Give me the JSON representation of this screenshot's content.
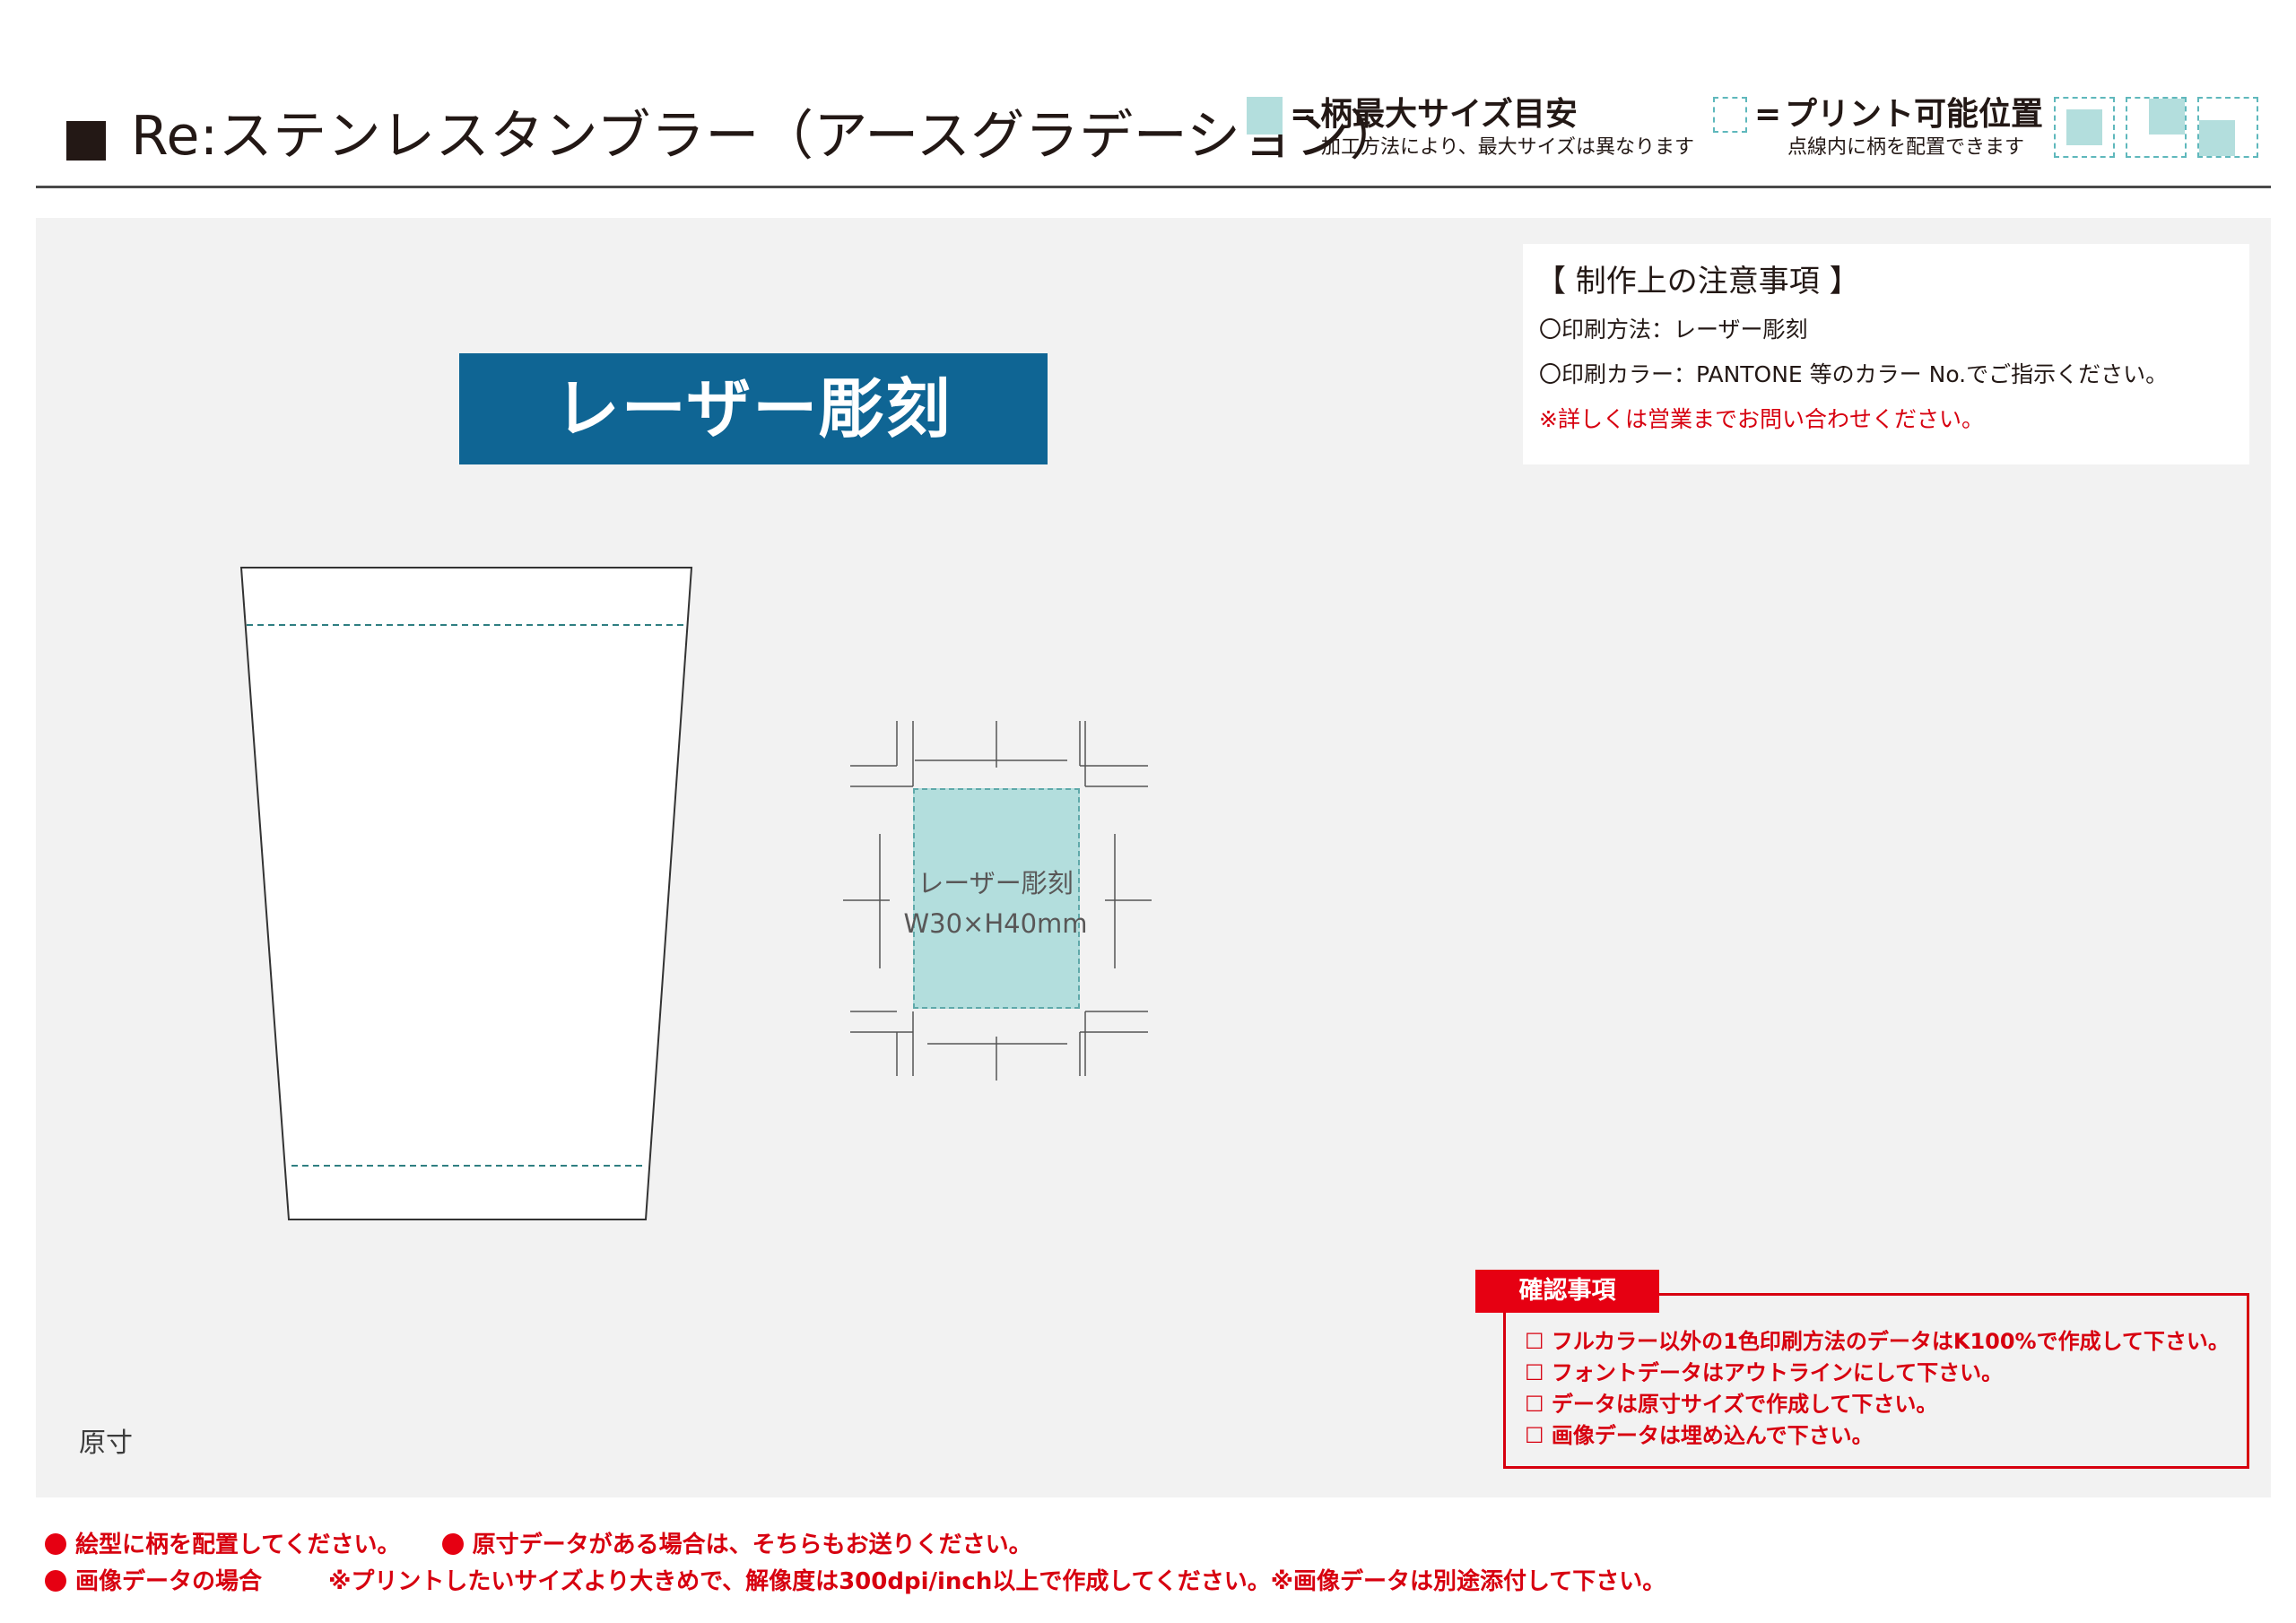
{
  "header": {
    "title": "Re:ステンレスタンブラー（アースグラデーション）",
    "legend_max": {
      "eq": "=",
      "title": "柄最大サイズ目安",
      "note": "加工方法により、最大サイズは異なります",
      "color": "#b3dedd"
    },
    "legend_print": {
      "eq": "=",
      "title": "プリント可能位置",
      "note": "点線内に柄を配置できます",
      "color": "#5fb8bc"
    }
  },
  "banner": {
    "label": "レーザー彫刻",
    "color": "#0f6594"
  },
  "notes": {
    "title": "【 制作上の注意事項 】",
    "lines": [
      "〇印刷方法：レーザー彫刻",
      "〇印刷カラー：PANTONE 等のカラー No.でご指示ください。",
      "※詳しくは営業までお問い合わせください。"
    ]
  },
  "print_area": {
    "line1": "レーザー彫刻",
    "line2": "W30×H40mm"
  },
  "original_label": "原寸",
  "confirm": {
    "title": "確認事項",
    "items": [
      "☐ フルカラー以外の1色印刷方法のデータはK100%で作成して下さい。",
      "☐ フォントデータはアウトラインにして下さい。",
      "☐ データは原寸サイズで作成して下さい。",
      "☐ 画像データは埋め込んで下さい。"
    ]
  },
  "footer": {
    "line1a": "絵型に柄を配置してください。",
    "line1b": "原寸データがある場合は、そちらもお送りください。",
    "line2a": "画像データの場合",
    "line2b": "※プリントしたいサイズより大きめで、解像度は300dpi/inch以上で作成してください。※画像データは別途添付して下さい。"
  },
  "colors": {
    "accent_red": "#e60012",
    "text_dark": "#231815",
    "panel_bg": "#f2f2f2"
  }
}
